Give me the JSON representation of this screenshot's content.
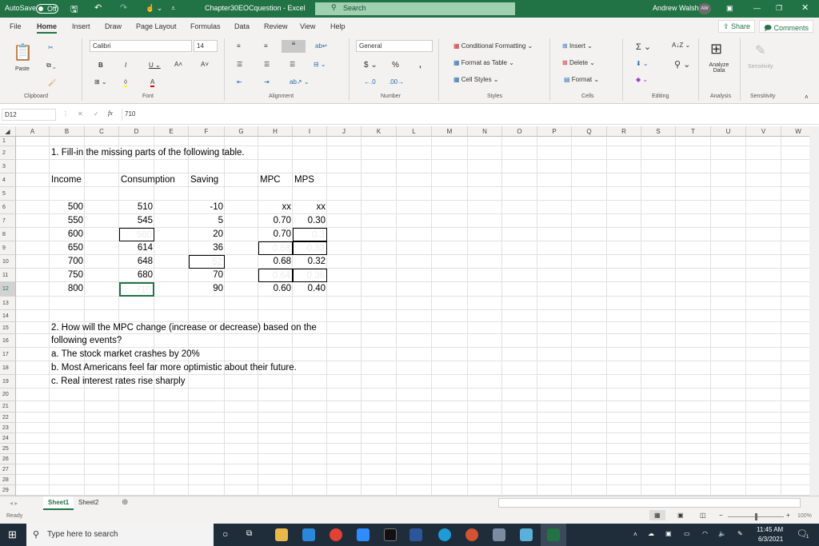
{
  "titlebar": {
    "autosave": "AutoSave",
    "autosave_state": "Off",
    "doc_title": "Chapter30EOCquestion  -  Excel",
    "search": "Search",
    "user": "Andrew Walsh",
    "initials": "AW"
  },
  "menu_tabs": [
    "File",
    "Home",
    "Insert",
    "Draw",
    "Page Layout",
    "Formulas",
    "Data",
    "Review",
    "View",
    "Help"
  ],
  "share": "Share",
  "comments": "Comments",
  "ribbon": {
    "paste": "Paste",
    "font_name": "Calibri",
    "font_size": "14",
    "number_format": "General",
    "conditional_formatting": "Conditional Formatting",
    "format_as_table": "Format as Table",
    "cell_styles": "Cell Styles",
    "insert": "Insert",
    "delete": "Delete",
    "format": "Format",
    "analyze_data": "Analyze Data",
    "sensitivity": "Sensitivity",
    "groups": [
      "Clipboard",
      "Font",
      "Alignment",
      "Number",
      "Styles",
      "Cells",
      "Editing",
      "Analysis",
      "Sensitivity"
    ]
  },
  "formula_bar": {
    "name_box": "D12",
    "fx": "fx",
    "value": "710"
  },
  "columns": [
    "A",
    "B",
    "C",
    "D",
    "E",
    "F",
    "G",
    "H",
    "I",
    "J",
    "K",
    "L",
    "M",
    "N",
    "O",
    "P",
    "Q",
    "R",
    "S",
    "T",
    "U",
    "V",
    "W"
  ],
  "cells": [
    {
      "ref": "B2",
      "v": "1. Fill-in the missing parts of the following table."
    },
    {
      "ref": "B4",
      "v": "Income"
    },
    {
      "ref": "D4",
      "v": "Consumption",
      "left": true
    },
    {
      "ref": "F4",
      "v": "Saving",
      "left": true
    },
    {
      "ref": "H4",
      "v": "MPC",
      "left": true
    },
    {
      "ref": "I4",
      "v": "MPS",
      "left": true
    },
    {
      "ref": "B6",
      "v": "500",
      "num": true
    },
    {
      "ref": "D6",
      "v": "510",
      "num": true
    },
    {
      "ref": "F6",
      "v": "-10",
      "num": true
    },
    {
      "ref": "H6",
      "v": "xx",
      "num": true
    },
    {
      "ref": "I6",
      "v": "xx",
      "num": true
    },
    {
      "ref": "B7",
      "v": "550",
      "num": true
    },
    {
      "ref": "D7",
      "v": "545",
      "num": true
    },
    {
      "ref": "F7",
      "v": "5",
      "num": true
    },
    {
      "ref": "H7",
      "v": "0.70",
      "num": true
    },
    {
      "ref": "I7",
      "v": "0.30",
      "num": true
    },
    {
      "ref": "B8",
      "v": "600",
      "num": true
    },
    {
      "ref": "D8",
      "v": "580",
      "num": true,
      "boxed": true,
      "faint": true
    },
    {
      "ref": "F8",
      "v": "20",
      "num": true
    },
    {
      "ref": "H8",
      "v": "0.70",
      "num": true
    },
    {
      "ref": "I8",
      "v": "0.3",
      "num": true,
      "boxed": true,
      "faint": true
    },
    {
      "ref": "B9",
      "v": "650",
      "num": true
    },
    {
      "ref": "D9",
      "v": "614",
      "num": true
    },
    {
      "ref": "F9",
      "v": "36",
      "num": true
    },
    {
      "ref": "H9",
      "v": "0.68",
      "num": true,
      "boxed": true,
      "faint": true
    },
    {
      "ref": "I9",
      "v": "0.32",
      "num": true,
      "boxed": true,
      "faint": true
    },
    {
      "ref": "B10",
      "v": "700",
      "num": true
    },
    {
      "ref": "D10",
      "v": "648",
      "num": true
    },
    {
      "ref": "F10",
      "v": "52",
      "num": true,
      "boxed": true,
      "faint": true
    },
    {
      "ref": "H10",
      "v": "0.68",
      "num": true
    },
    {
      "ref": "I10",
      "v": "0.32",
      "num": true
    },
    {
      "ref": "B11",
      "v": "750",
      "num": true
    },
    {
      "ref": "D11",
      "v": "680",
      "num": true
    },
    {
      "ref": "F11",
      "v": "70",
      "num": true
    },
    {
      "ref": "H11",
      "v": "0.64",
      "num": true,
      "boxed": true,
      "faint": true
    },
    {
      "ref": "I11",
      "v": "0.36",
      "num": true,
      "boxed": true,
      "faint": true
    },
    {
      "ref": "B12",
      "v": "800",
      "num": true
    },
    {
      "ref": "D12",
      "v": "710",
      "num": true,
      "active": true,
      "faint": true
    },
    {
      "ref": "F12",
      "v": "90",
      "num": true
    },
    {
      "ref": "H12",
      "v": "0.60",
      "num": true
    },
    {
      "ref": "I12",
      "v": "0.40",
      "num": true
    },
    {
      "ref": "B15",
      "v": "2. How will the MPC change (increase or decrease) based on the"
    },
    {
      "ref": "B16",
      "v": "following events?"
    },
    {
      "ref": "B17",
      "v": "a. The stock market crashes by 20%"
    },
    {
      "ref": "B18",
      "v": "b. Most Americans feel far more optimistic about their future."
    },
    {
      "ref": "B19",
      "v": "c. Real interest rates rise sharply"
    }
  ],
  "sheets": [
    "Sheet1",
    "Sheet2"
  ],
  "status": {
    "ready": "Ready",
    "zoom": "100%",
    "zoom_fraction": 0.5
  },
  "taskbar": {
    "search": "Type here to search",
    "time": "11:45 AM",
    "date": "6/3/2021",
    "notifications": "1"
  },
  "colors": {
    "excel_green": "#217346",
    "taskbar": "#1f2d3a"
  }
}
